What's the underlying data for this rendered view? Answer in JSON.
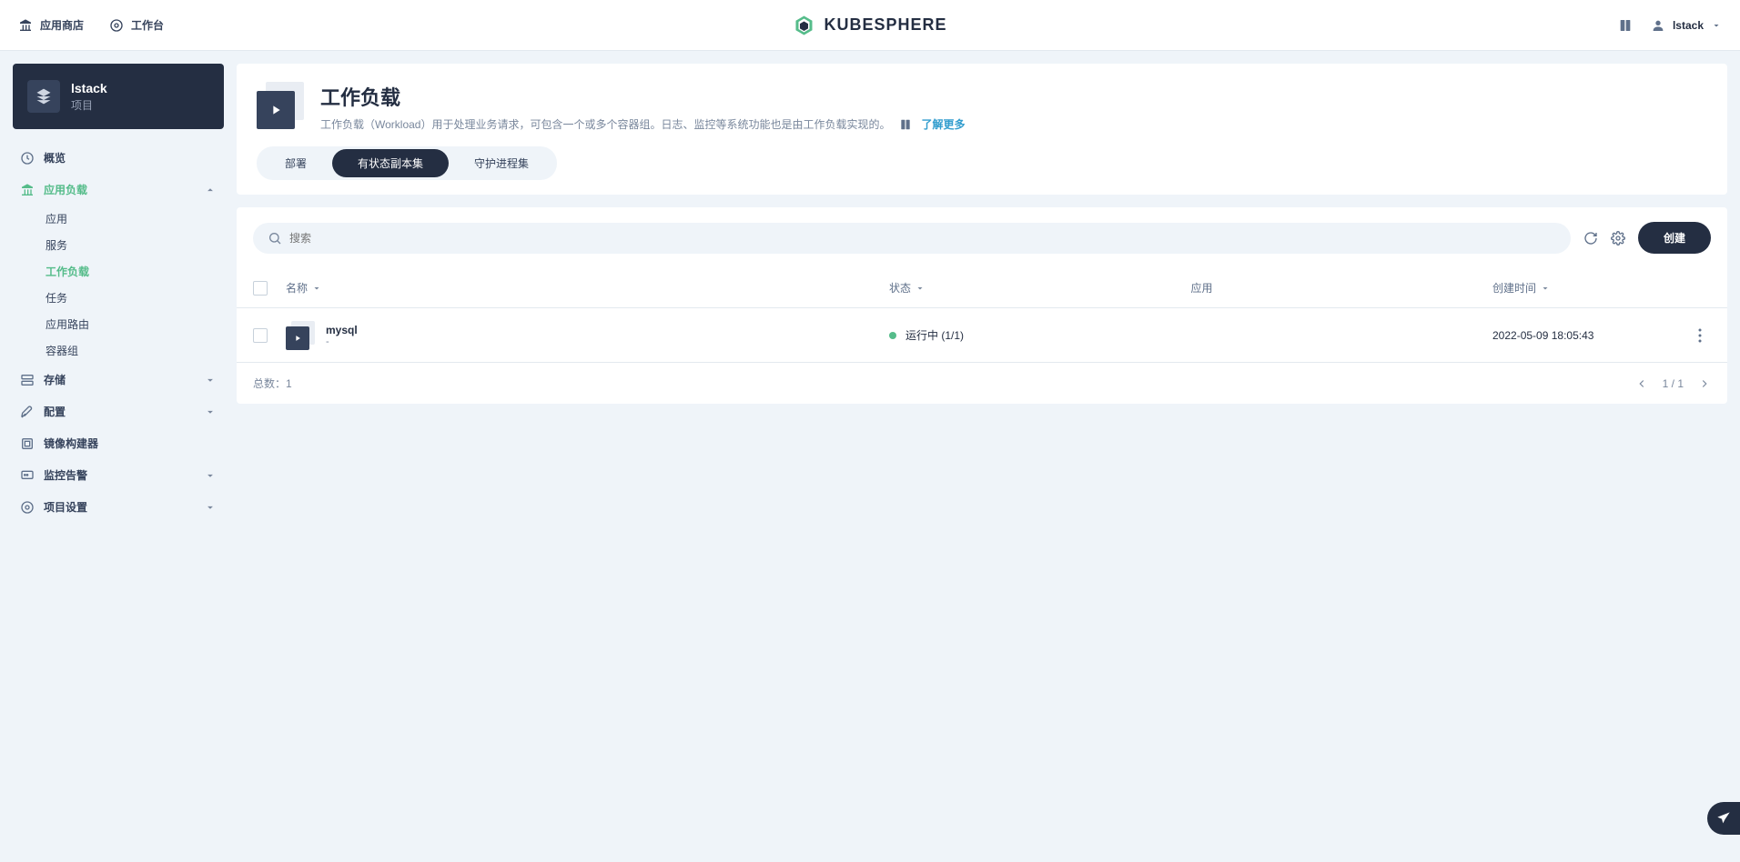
{
  "header": {
    "app_store": "应用商店",
    "workbench": "工作台",
    "brand": "KUBESPHERE",
    "user": "lstack"
  },
  "project": {
    "name": "lstack",
    "type": "项目"
  },
  "sidebar": {
    "items": [
      {
        "label": "概览",
        "kind": "item"
      },
      {
        "label": "应用负载",
        "kind": "expand",
        "expanded": true,
        "active": true,
        "children": [
          {
            "label": "应用"
          },
          {
            "label": "服务"
          },
          {
            "label": "工作负载",
            "active": true
          },
          {
            "label": "任务"
          },
          {
            "label": "应用路由"
          },
          {
            "label": "容器组"
          }
        ]
      },
      {
        "label": "存储",
        "kind": "expand",
        "expanded": false
      },
      {
        "label": "配置",
        "kind": "expand",
        "expanded": false
      },
      {
        "label": "镜像构建器",
        "kind": "item"
      },
      {
        "label": "监控告警",
        "kind": "expand",
        "expanded": false
      },
      {
        "label": "项目设置",
        "kind": "expand",
        "expanded": false
      }
    ]
  },
  "banner": {
    "title": "工作负载",
    "desc": "工作负载（Workload）用于处理业务请求，可包含一个或多个容器组。日志、监控等系统功能也是由工作负载实现的。",
    "learn_more": "了解更多"
  },
  "tabs": {
    "items": [
      "部署",
      "有状态副本集",
      "守护进程集"
    ],
    "active_index": 1
  },
  "toolbar": {
    "search_placeholder": "搜索",
    "create_label": "创建"
  },
  "table": {
    "columns": {
      "name": "名称",
      "status": "状态",
      "app": "应用",
      "time": "创建时间"
    },
    "rows": [
      {
        "name": "mysql",
        "sub": "-",
        "status": "运行中 (1/1)",
        "app": "",
        "time": "2022-05-09 18:05:43"
      }
    ]
  },
  "footer": {
    "total_label": "总数：",
    "total": "1",
    "page": "1 / 1"
  }
}
